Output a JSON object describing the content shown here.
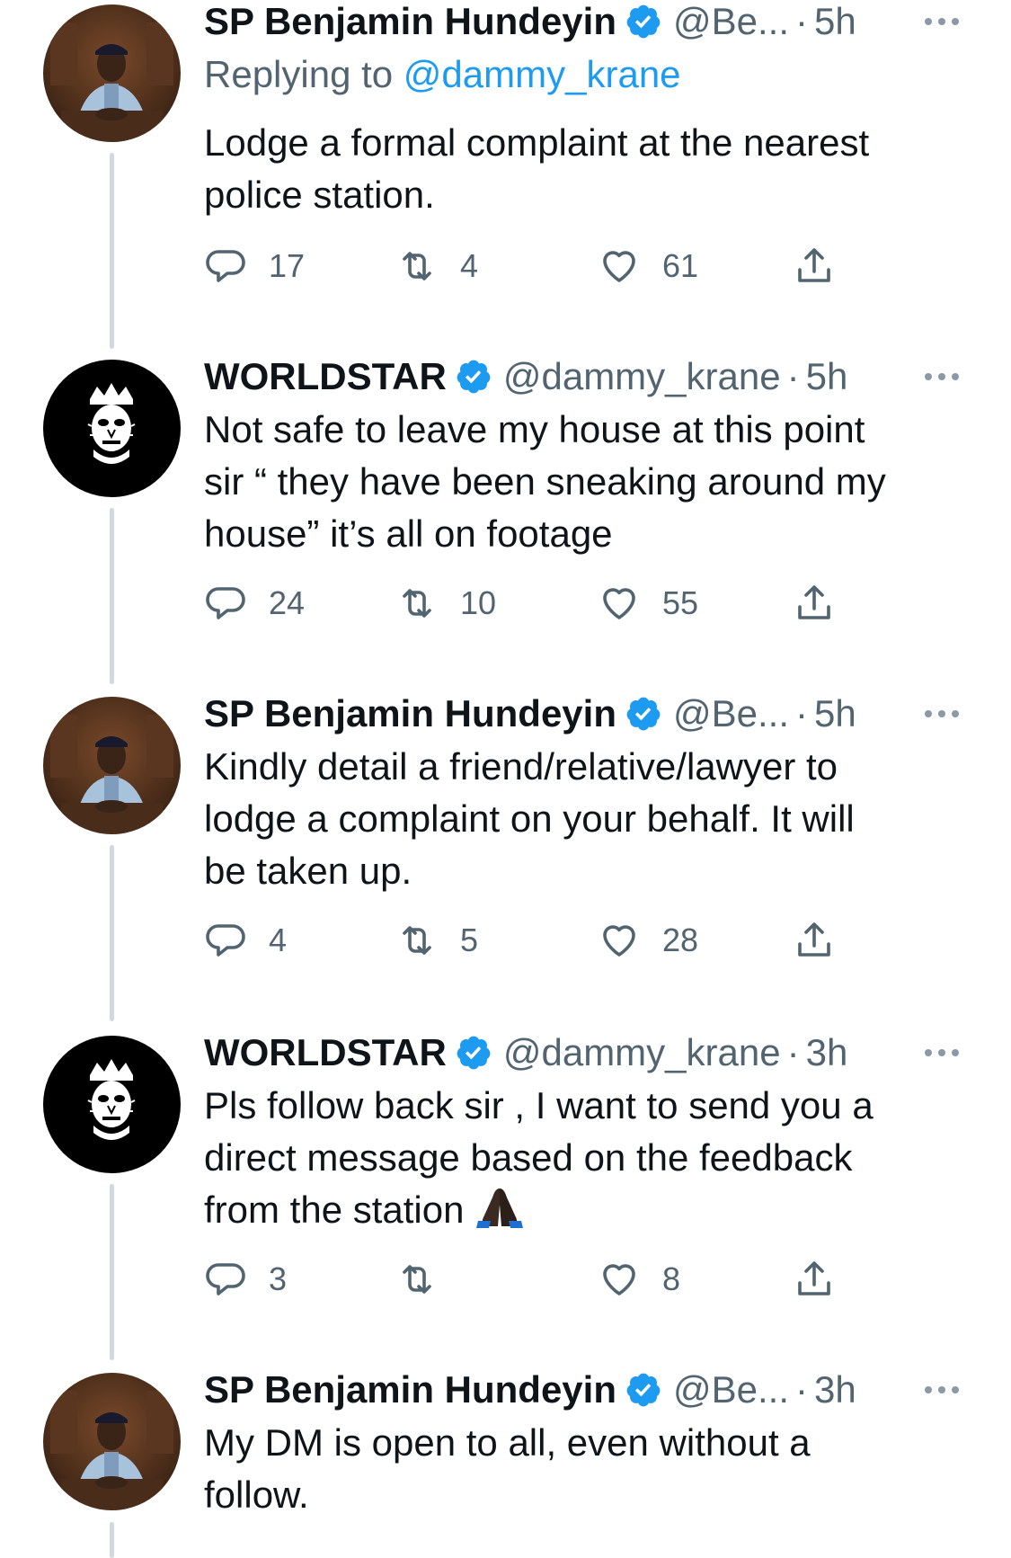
{
  "tweets": [
    {
      "author": "SP Benjamin Hundeyin",
      "handle": "@Be...",
      "separator": "·",
      "time": "5h",
      "avatar": "police-officer-avatar",
      "verified": true,
      "replying_prefix": "Replying to",
      "replying_to": "@dammy_krane",
      "lines": [
        "Lodge a formal complaint at the nearest",
        "police station."
      ],
      "replies": "17",
      "retweets": "4",
      "likes": "61"
    },
    {
      "author": "WORLDSTAR",
      "handle": "@dammy_krane",
      "separator": "·",
      "time": "5h",
      "avatar": "crowned-face-avatar",
      "verified": true,
      "lines": [
        "Not safe to leave my house at this point",
        "sir  “ they have been sneaking around my",
        "house” it’s all on footage"
      ],
      "replies": "24",
      "retweets": "10",
      "likes": "55"
    },
    {
      "author": "SP Benjamin Hundeyin",
      "handle": "@Be...",
      "separator": "·",
      "time": "5h",
      "avatar": "police-officer-avatar",
      "verified": true,
      "lines": [
        "Kindly detail a friend/relative/lawyer to",
        "lodge a complaint on your behalf. It will",
        "be taken up."
      ],
      "replies": "4",
      "retweets": "5",
      "likes": "28"
    },
    {
      "author": "WORLDSTAR",
      "handle": "@dammy_krane",
      "separator": "·",
      "time": "3h",
      "avatar": "crowned-face-avatar",
      "verified": true,
      "lines": [
        "Pls follow back sir , I want to send you a",
        "direct message based on the feedback",
        "from the station"
      ],
      "emoji": "praying-hands-emoji",
      "replies": "3",
      "retweets": "",
      "likes": "8"
    },
    {
      "author": "SP Benjamin Hundeyin",
      "handle": "@Be...",
      "separator": "·",
      "time": "3h",
      "avatar": "police-officer-avatar",
      "verified": true,
      "lines": [
        "My DM is open to all, even without a",
        "follow."
      ]
    }
  ],
  "colors": {
    "text": "#0f1419",
    "secondary": "#536471",
    "verified": "#1d9bf0",
    "mention": "#1d9bf0",
    "thread_line": "#cfd9de"
  },
  "icons": {
    "verified": "verified-badge-icon",
    "more": "more-dots-icon",
    "reply": "reply-bubble-icon",
    "retweet": "retweet-icon",
    "like": "heart-icon",
    "share": "share-icon"
  }
}
